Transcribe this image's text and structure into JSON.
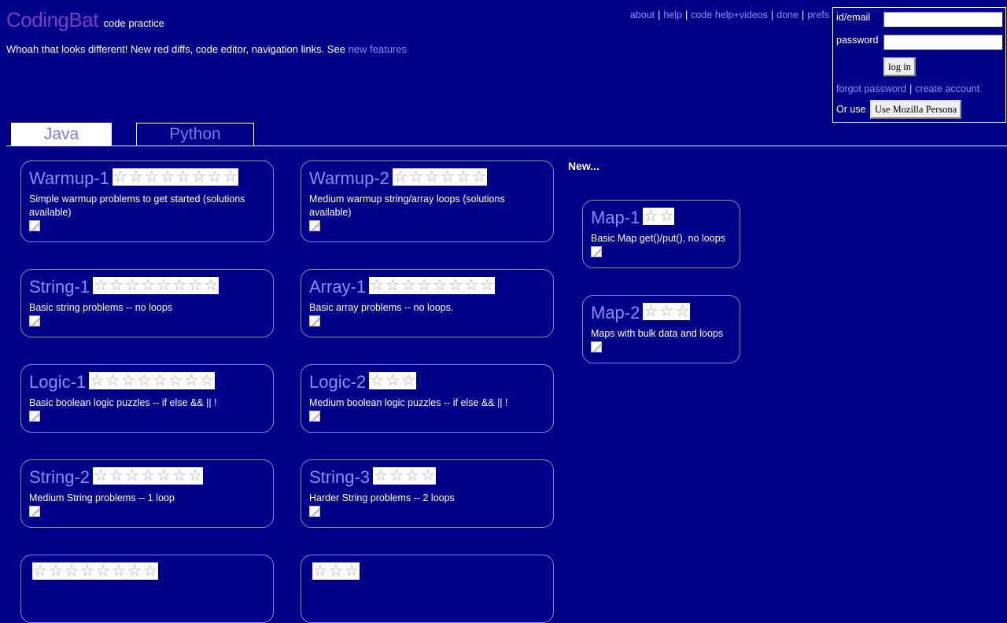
{
  "header": {
    "brand": "CodingBat",
    "tagline": "code practice",
    "notice_text": "Whoah that looks different! New red diffs, code editor, navigation links. See",
    "notice_link": "new features"
  },
  "toplinks": [
    "about",
    "help",
    "code help+videos",
    "done",
    "prefs"
  ],
  "login": {
    "id_label": "id/email",
    "password_label": "password",
    "id_value": "",
    "password_value": "",
    "login_button": "log in",
    "forgot_link": "forgot password",
    "create_link": "create account",
    "or_use": "Or use",
    "persona_button": "Use Mozilla Persona"
  },
  "tabs": [
    {
      "label": "Java",
      "active": true
    },
    {
      "label": "Python",
      "active": false
    }
  ],
  "new_heading": "New...",
  "cards": [
    {
      "title": "Warmup-1",
      "stars": 8,
      "desc": "Simple warmup problems to get started (solutions available)"
    },
    {
      "title": "Warmup-2",
      "stars": 6,
      "desc": "Medium warmup string/array loops (solutions available)"
    },
    {
      "title": "String-1",
      "stars": 8,
      "desc": "Basic string problems -- no loops"
    },
    {
      "title": "Array-1",
      "stars": 8,
      "desc": "Basic array problems -- no loops."
    },
    {
      "title": "Logic-1",
      "stars": 8,
      "desc": "Basic boolean logic puzzles -- if else && || !"
    },
    {
      "title": "Logic-2",
      "stars": 3,
      "desc": "Medium boolean logic puzzles -- if else && || !"
    },
    {
      "title": "String-2",
      "stars": 7,
      "desc": "Medium String problems -- 1 loop"
    },
    {
      "title": "String-3",
      "stars": 4,
      "desc": "Harder String problems -- 2 loops"
    },
    {
      "title": "",
      "stars": 8,
      "desc": ""
    },
    {
      "title": "",
      "stars": 3,
      "desc": ""
    }
  ],
  "new_cards": [
    {
      "title": "Map-1",
      "stars": 2,
      "desc": "Basic Map get()/put(), no loops"
    },
    {
      "title": "Map-2",
      "stars": 3,
      "desc": "Maps with bulk data and loops"
    }
  ],
  "colors": {
    "background": "#000088",
    "link": "#8c8cff",
    "brand": "#7a3dc0",
    "text": "#ffffff"
  }
}
